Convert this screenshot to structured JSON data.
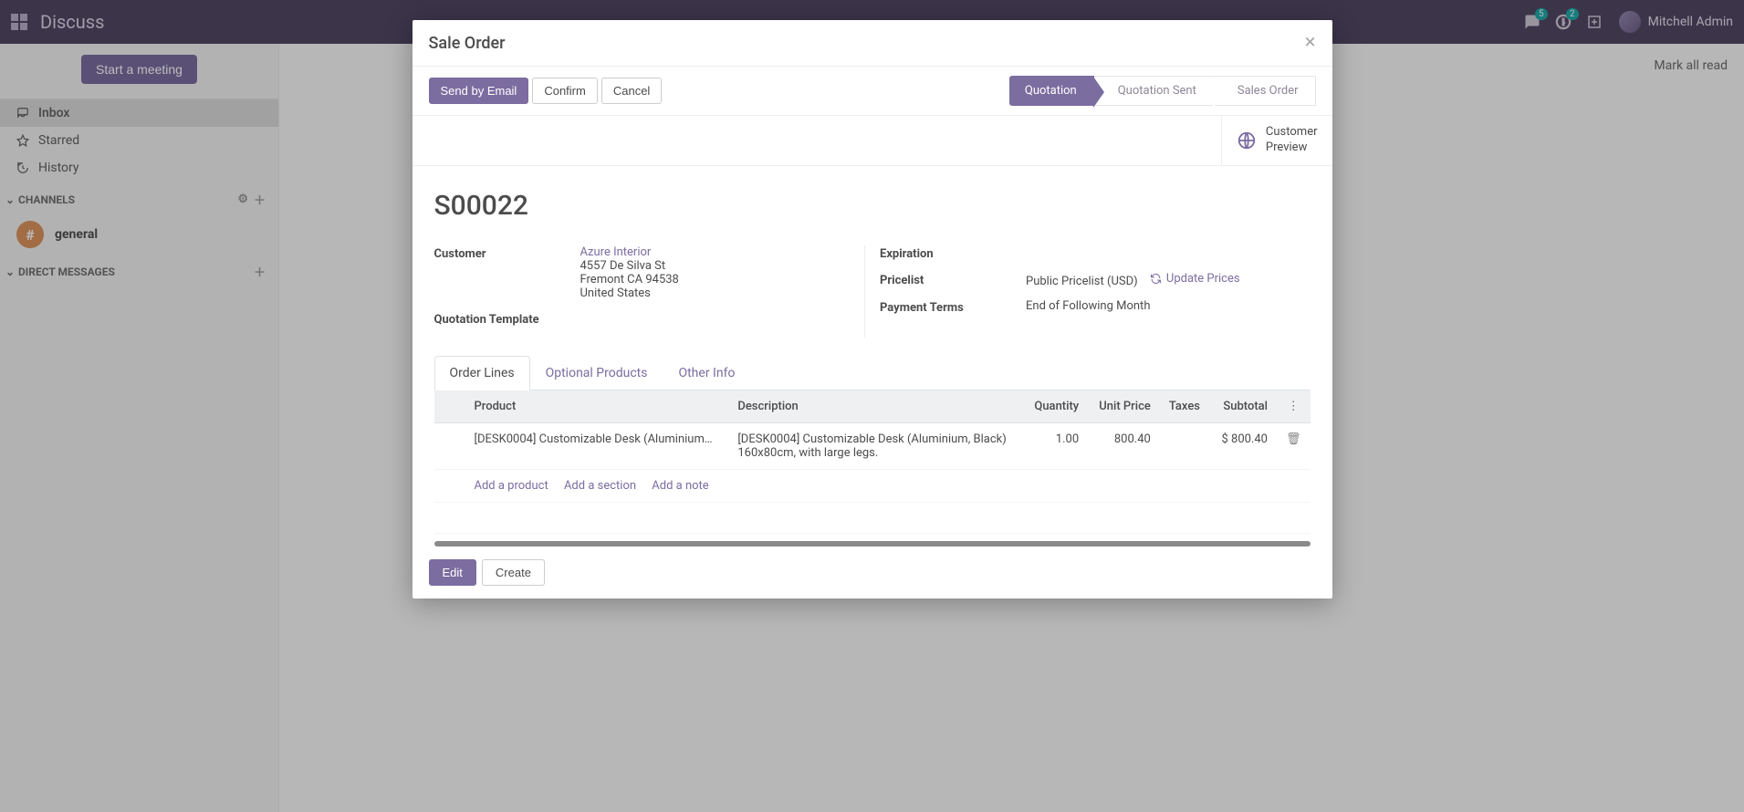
{
  "navbar": {
    "brand": "Discuss",
    "messages_badge": "5",
    "activities_badge": "2",
    "user_name": "Mitchell Admin"
  },
  "sidebar": {
    "start_meeting": "Start a meeting",
    "mailboxes": {
      "inbox": "Inbox",
      "starred": "Starred",
      "history": "History"
    },
    "channels_header": "CHANNELS",
    "channel_general": "general",
    "direct_messages_header": "DIRECT MESSAGES"
  },
  "main": {
    "mark_all_read": "Mark all read"
  },
  "modal": {
    "title": "Sale Order",
    "buttons": {
      "send_email": "Send by Email",
      "confirm": "Confirm",
      "cancel": "Cancel"
    },
    "status_steps": {
      "quotation": "Quotation",
      "quotation_sent": "Quotation Sent",
      "sales_order": "Sales Order"
    },
    "customer_preview_label": "Customer\nPreview",
    "customer_preview_line1": "Customer",
    "customer_preview_line2": "Preview",
    "order_name": "S00022",
    "fields": {
      "customer_label": "Customer",
      "customer_name": "Azure Interior",
      "address_line1": "4557 De Silva St",
      "address_line2": "Fremont CA 94538",
      "address_line3": "United States",
      "quotation_template_label": "Quotation Template",
      "expiration_label": "Expiration",
      "pricelist_label": "Pricelist",
      "pricelist_value": "Public Pricelist (USD)",
      "update_prices": "Update Prices",
      "payment_terms_label": "Payment Terms",
      "payment_terms_value": "End of Following Month"
    },
    "tabs": {
      "order_lines": "Order Lines",
      "optional_products": "Optional Products",
      "other_info": "Other Info"
    },
    "table": {
      "headers": {
        "product": "Product",
        "description": "Description",
        "quantity": "Quantity",
        "unit_price": "Unit Price",
        "taxes": "Taxes",
        "subtotal": "Subtotal"
      },
      "rows": [
        {
          "product": "[DESK0004] Customizable Desk (Aluminium…",
          "description_line1": "[DESK0004] Customizable Desk (Aluminium, Black)",
          "description_line2": "160x80cm, with large legs.",
          "quantity": "1.00",
          "unit_price": "800.40",
          "subtotal": "$ 800.40"
        }
      ],
      "add_product": "Add a product",
      "add_section": "Add a section",
      "add_note": "Add a note"
    },
    "footer": {
      "edit": "Edit",
      "create": "Create"
    }
  }
}
